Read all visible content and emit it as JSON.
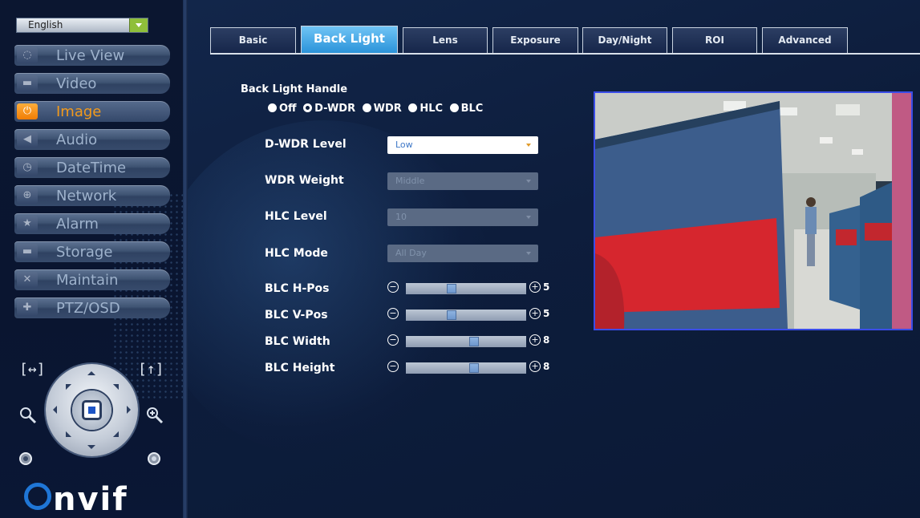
{
  "language": {
    "selected": "English"
  },
  "sidebar": {
    "items": [
      {
        "label": "Live View",
        "icon": "chat-bubble-icon",
        "glyph": "◌"
      },
      {
        "label": "Video",
        "icon": "camcorder-icon",
        "glyph": "▬"
      },
      {
        "label": "Image",
        "icon": "power-icon",
        "glyph": "⏻",
        "active": true
      },
      {
        "label": "Audio",
        "icon": "speaker-icon",
        "glyph": "◀"
      },
      {
        "label": "DateTime",
        "icon": "clock-icon",
        "glyph": "◷"
      },
      {
        "label": "Network",
        "icon": "network-icon",
        "glyph": "⊕"
      },
      {
        "label": "Alarm",
        "icon": "alarm-star-icon",
        "glyph": "★"
      },
      {
        "label": "Storage",
        "icon": "storage-drive-icon",
        "glyph": "▬"
      },
      {
        "label": "Maintain",
        "icon": "tools-icon",
        "glyph": "✕"
      },
      {
        "label": "PTZ/OSD",
        "icon": "ptz-icon",
        "glyph": "✚"
      }
    ]
  },
  "ptz": {
    "fit_label": "[↔]",
    "focus_label": "[↑]"
  },
  "brand": {
    "logo_text": "nvif"
  },
  "tabs": [
    {
      "label": "Basic"
    },
    {
      "label": "Back Light",
      "active": true
    },
    {
      "label": "Lens"
    },
    {
      "label": "Exposure"
    },
    {
      "label": "Day/Night"
    },
    {
      "label": "ROI"
    },
    {
      "label": "Advanced"
    }
  ],
  "backlight": {
    "handle_label": "Back Light Handle",
    "modes": [
      "Off",
      "D-WDR",
      "WDR",
      "HLC",
      "BLC"
    ],
    "selected_mode": "D-WDR",
    "dwdr_level": {
      "label": "D-WDR Level",
      "value": "Low",
      "enabled": true
    },
    "wdr_weight": {
      "label": "WDR Weight",
      "value": "Middle",
      "enabled": false
    },
    "hlc_level": {
      "label": "HLC Level",
      "value": "10",
      "enabled": false
    },
    "hlc_mode": {
      "label": "HLC Mode",
      "value": "All Day",
      "enabled": false
    },
    "blc_h_pos": {
      "label": "BLC H-Pos",
      "value": "5"
    },
    "blc_v_pos": {
      "label": "BLC V-Pos",
      "value": "5"
    },
    "blc_width": {
      "label": "BLC Width",
      "value": "8"
    },
    "blc_height": {
      "label": "BLC Height",
      "value": "8"
    }
  },
  "colors": {
    "accent_active_tab": "#2b93d9",
    "active_nav": "#f29a1c",
    "preview_border": "#3b4de8"
  }
}
